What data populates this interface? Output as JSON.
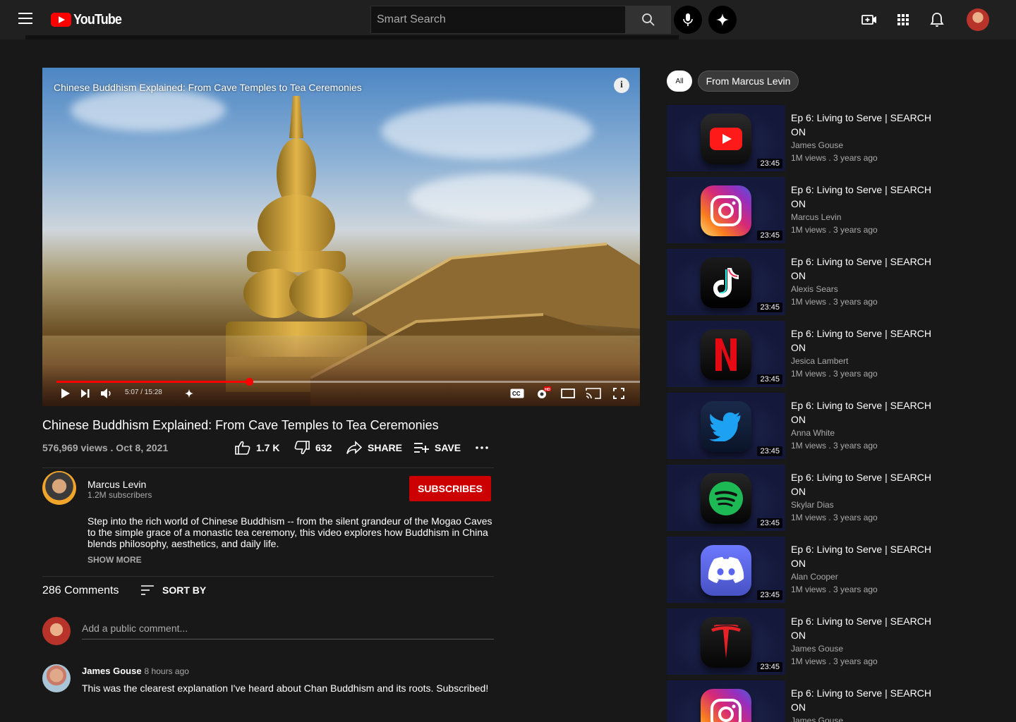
{
  "header": {
    "logo_text": "YouTube",
    "search_placeholder": "Smart Search"
  },
  "player": {
    "overlay_title": "Chinese Buddhism Explained: From Cave Temples to Tea Ceremonies",
    "time": "5:07 / 15:28",
    "progress": 0.33
  },
  "video": {
    "title": "Chinese Buddhism Explained: From Cave Temples to Tea Ceremonies",
    "views": "576,969 views . Oct 8, 2021",
    "likes": "1.7 K",
    "dislikes": "632",
    "share_label": "SHARE",
    "save_label": "SAVE"
  },
  "channel": {
    "name": "Marcus Levin",
    "subscribers": "1.2M subscribers",
    "subscribe_label": "SUBSCRIBES"
  },
  "description": {
    "text": "Step into the rich world of Chinese Buddhism -- from the silent grandeur of the Mogao Caves to the simple grace of a monastic tea ceremony, this video explores how Buddhism in China blends philosophy, aesthetics, and daily life.",
    "show_more": "SHOW MORE"
  },
  "comments": {
    "count": "286 Comments",
    "sort_label": "SORT BY",
    "input_placeholder": "Add a public comment...",
    "items": [
      {
        "author": "James Gouse",
        "time": "8 hours ago",
        "text": "This was the clearest explanation I've heard about Chan Buddhism and its roots. Subscribed!"
      }
    ]
  },
  "sidebar": {
    "chips": [
      "All",
      "From Marcus Levin"
    ],
    "recommendations": [
      {
        "title": "Ep 6: Living to Serve | SEARCH ON",
        "channel": "James Gouse",
        "meta": "1M views . 3 years ago",
        "duration": "23:45",
        "icon": "youtube-icon",
        "color": "#e62117"
      },
      {
        "title": "Ep 6: Living to Serve | SEARCH ON",
        "channel": "Marcus Levin",
        "meta": "1M views . 3 years ago",
        "duration": "23:45",
        "icon": "instagram-icon",
        "color": "#c13584"
      },
      {
        "title": "Ep 6: Living to Serve | SEARCH ON",
        "channel": "Alexis Sears",
        "meta": "1M views . 3 years ago",
        "duration": "23:45",
        "icon": "tiktok-icon",
        "color": "#111111"
      },
      {
        "title": "Ep 6: Living to Serve | SEARCH ON",
        "channel": "Jesica Lambert",
        "meta": "1M views . 3 years ago",
        "duration": "23:45",
        "icon": "netflix-icon",
        "color": "#1a1a2a"
      },
      {
        "title": "Ep 6: Living to Serve | SEARCH ON",
        "channel": "Anna White",
        "meta": "1M views . 3 years ago",
        "duration": "23:45",
        "icon": "twitter-icon",
        "color": "#1da1f2"
      },
      {
        "title": "Ep 6: Living to Serve | SEARCH ON",
        "channel": "Skylar Dias",
        "meta": "1M views . 3 years ago",
        "duration": "23:45",
        "icon": "spotify-icon",
        "color": "#1a1a1a"
      },
      {
        "title": "Ep 6: Living to Serve | SEARCH ON",
        "channel": "Alan Cooper",
        "meta": "1M views . 3 years ago",
        "duration": "23:45",
        "icon": "discord-icon",
        "color": "#5865f2"
      },
      {
        "title": "Ep 6: Living to Serve | SEARCH ON",
        "channel": "James Gouse",
        "meta": "1M views . 3 years ago",
        "duration": "23:45",
        "icon": "tesla-icon",
        "color": "#111111"
      },
      {
        "title": "Ep 6: Living to Serve | SEARCH ON",
        "channel": "James Gouse",
        "meta": "",
        "duration": "",
        "icon": "instagram-icon",
        "color": "#c13584"
      }
    ]
  },
  "colors": {
    "background": "#181818",
    "header": "#202020",
    "accent_red": "#ff0000",
    "subscribe_red": "#cc0000"
  }
}
